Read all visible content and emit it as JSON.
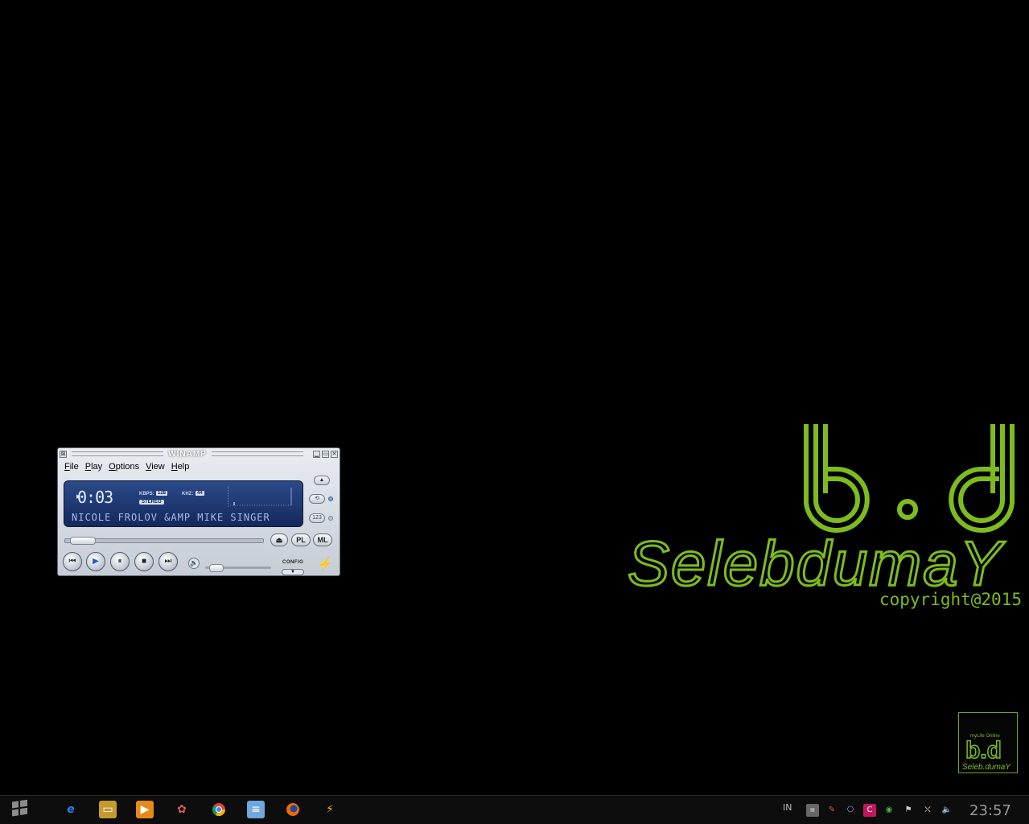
{
  "wallpaper": {
    "big_logo": "b.d",
    "name": "SelebdumaY",
    "copyright": "copyright@2015",
    "small_logo_line1": "myLife Online",
    "small_logo_line2": "b.d",
    "small_logo_line3": "Seleb.dumaY",
    "accent_color": "#7dbb1e"
  },
  "winamp": {
    "title": "WINAMP",
    "menu": [
      "File",
      "Play",
      "Options",
      "View",
      "Help"
    ],
    "time": "0:03",
    "kbps_label": "KBPS:",
    "kbps_value": "128",
    "khz_label": "KHZ:",
    "khz_value": "44",
    "stereo_label": "STEREO",
    "marquee": "NICOLE FROLOV &AMP  MIKE SINGER",
    "pl_label": "PL",
    "ml_label": "ML",
    "config_label": "CONFIG",
    "side_button_label": "123",
    "seek_position": 0.03,
    "volume_level": 0.05
  },
  "taskbar": {
    "start_icon": "windows-logo-icon",
    "apps": [
      {
        "name": "internet-explorer-icon",
        "color": "#1e88e5"
      },
      {
        "name": "file-explorer-icon",
        "color": "#f2c14e"
      },
      {
        "name": "media-player-icon",
        "color": "#e58a16"
      },
      {
        "name": "paint-icon",
        "color": "#c74c4c"
      },
      {
        "name": "chrome-icon",
        "color": "#4caf50"
      },
      {
        "name": "notepad-icon",
        "color": "#6fa8dc"
      },
      {
        "name": "firefox-icon",
        "color": "#ef6c00"
      },
      {
        "name": "winamp-icon",
        "color": "#f4b400"
      }
    ],
    "language": "IN",
    "clock": "23:57"
  }
}
